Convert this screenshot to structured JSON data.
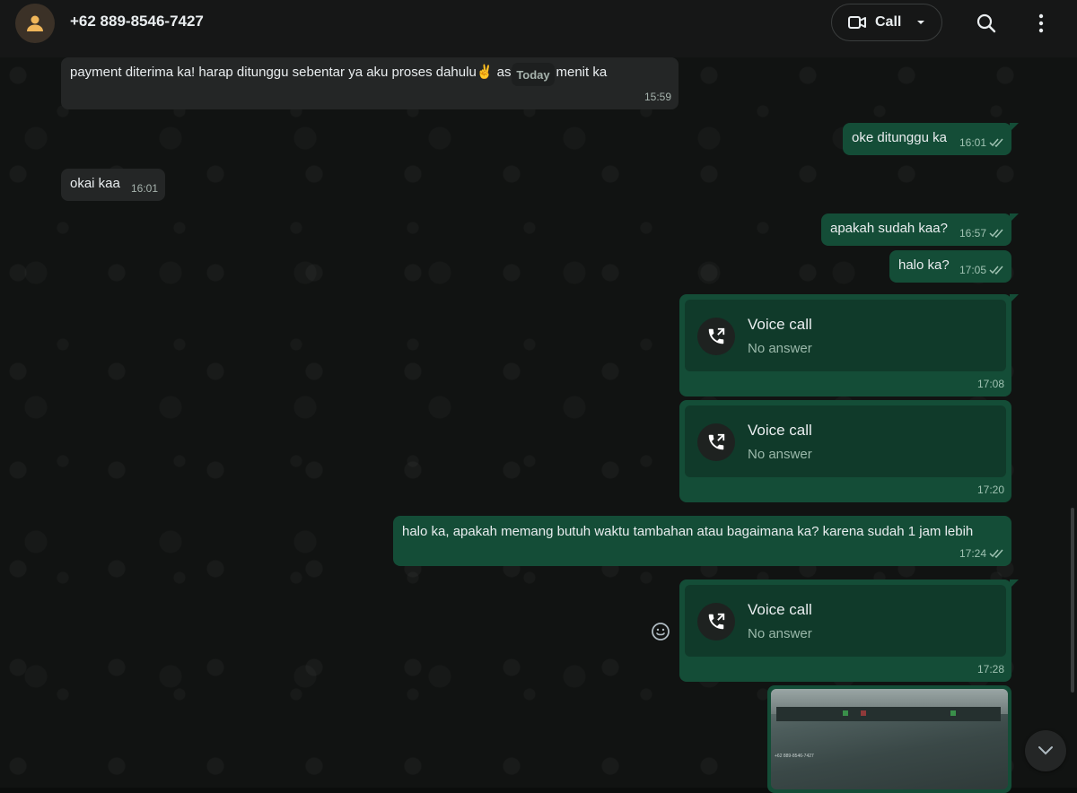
{
  "header": {
    "contact_name": "+62 889-8546-7427",
    "call_label": "Call"
  },
  "date_divider": "Today",
  "messages": [
    {
      "dir": "in",
      "text": "payment diterima ka! harap ditunggu sebentar ya aku proses dahulu✌️ asi 15-60 menit ka",
      "time": "15:59"
    },
    {
      "dir": "out",
      "text": "oke ditunggu ka",
      "time": "16:01"
    },
    {
      "dir": "in",
      "text": "okai kaa",
      "time": "16:01"
    },
    {
      "dir": "out",
      "text": "apakah sudah kaa?",
      "time": "16:57"
    },
    {
      "dir": "out",
      "text": "halo ka?",
      "time": "17:05"
    },
    {
      "dir": "out",
      "type": "call",
      "title": "Voice call",
      "subtitle": "No answer",
      "time": "17:08"
    },
    {
      "dir": "out",
      "type": "call",
      "title": "Voice call",
      "subtitle": "No answer",
      "time": "17:20"
    },
    {
      "dir": "out",
      "text": "halo ka, apakah memang butuh waktu tambahan atau bagaimana ka? karena sudah 1 jam lebih",
      "time": "17:24"
    },
    {
      "dir": "out",
      "type": "call",
      "title": "Voice call",
      "subtitle": "No answer",
      "time": "17:28"
    }
  ],
  "image_preview_text": "+62 889-8546-7427",
  "colors": {
    "outgoing_bubble": "#144d37",
    "incoming_bubble": "#242626",
    "header_bg": "#161717"
  }
}
